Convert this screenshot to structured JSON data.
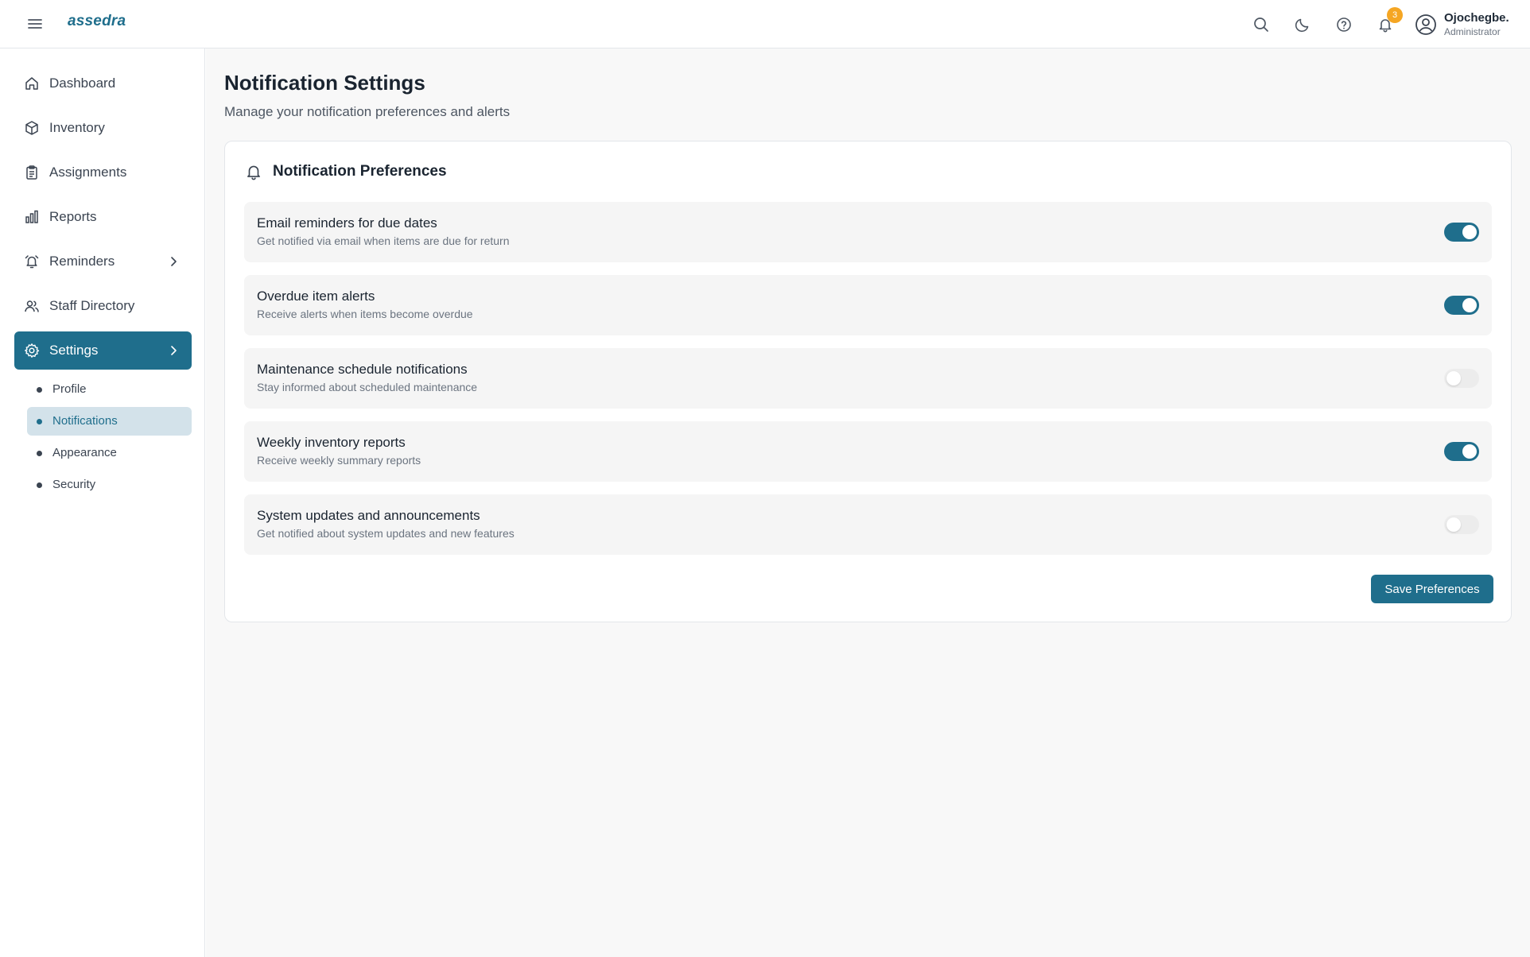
{
  "app": {
    "logo": "assedra"
  },
  "header": {
    "icons": [
      "menu-icon",
      "search-icon",
      "moon-icon",
      "help-icon",
      "bell-icon",
      "user-circle-icon"
    ],
    "notification_count": "3",
    "user": {
      "name": "Ojochegbe.",
      "role": "Administrator"
    }
  },
  "sidebar": {
    "items": [
      {
        "label": "Dashboard",
        "icon": "home-icon"
      },
      {
        "label": "Inventory",
        "icon": "box-icon"
      },
      {
        "label": "Assignments",
        "icon": "clipboard-icon"
      },
      {
        "label": "Reports",
        "icon": "bar-chart-icon"
      },
      {
        "label": "Reminders",
        "icon": "alarm-icon"
      },
      {
        "label": "Staff Directory",
        "icon": "users-icon"
      },
      {
        "label": "Settings",
        "icon": "gear-icon"
      }
    ],
    "settings_sub": [
      {
        "label": "Profile"
      },
      {
        "label": "Notifications"
      },
      {
        "label": "Appearance"
      },
      {
        "label": "Security"
      }
    ],
    "active_item": "Settings",
    "active_sub": "Notifications"
  },
  "main": {
    "title": "Notification Settings",
    "subtitle": "Manage your notification preferences and alerts",
    "card": {
      "title": "Notification Preferences",
      "preferences": [
        {
          "title": "Email reminders for due dates",
          "description": "Get notified via email when items are due for return",
          "enabled": true
        },
        {
          "title": "Overdue item alerts",
          "description": "Receive alerts when items become overdue",
          "enabled": true
        },
        {
          "title": "Maintenance schedule notifications",
          "description": "Stay informed about scheduled maintenance",
          "enabled": false
        },
        {
          "title": "Weekly inventory reports",
          "description": "Receive weekly summary reports",
          "enabled": true
        },
        {
          "title": "System updates and announcements",
          "description": "Get notified about system updates and new features",
          "enabled": false
        }
      ],
      "save_label": "Save Preferences"
    }
  },
  "colors": {
    "accent": "#1f6e8c",
    "badge": "#f5a623",
    "active_sub_bg": "#d3e2ea"
  }
}
